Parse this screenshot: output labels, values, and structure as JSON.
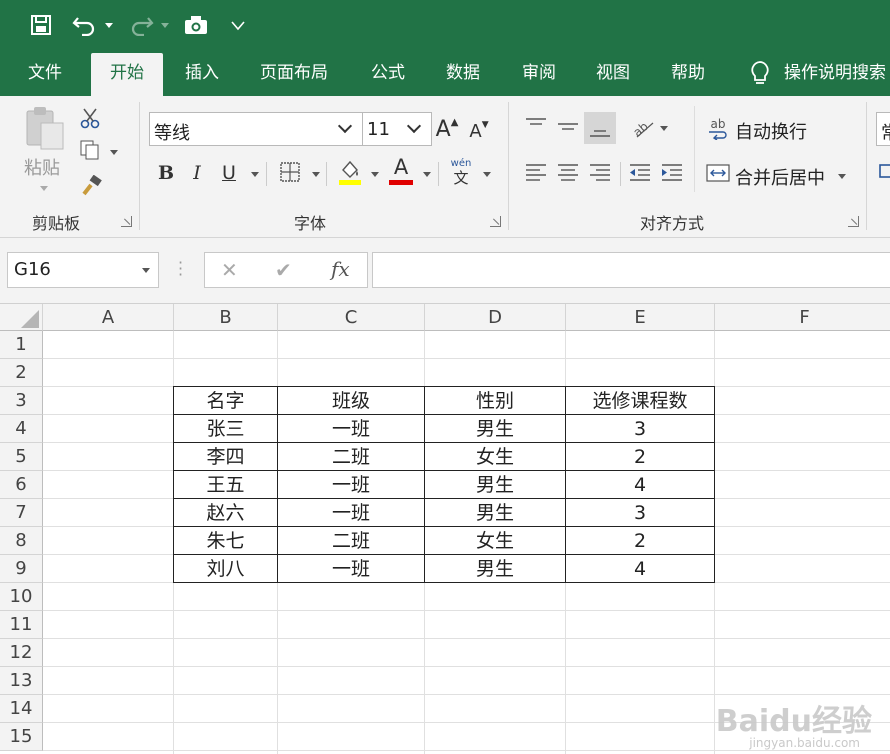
{
  "quick_access": {
    "save_icon": "save-icon",
    "undo_icon": "undo-icon",
    "redo_icon": "redo-icon",
    "camera_icon": "camera-icon",
    "customize_icon": "customize-qat-icon"
  },
  "tabs": [
    "文件",
    "开始",
    "插入",
    "页面布局",
    "公式",
    "数据",
    "审阅",
    "视图",
    "帮助"
  ],
  "tell_me": "操作说明搜索",
  "ribbon": {
    "clipboard": {
      "paste_label": "粘贴",
      "group_label": "剪贴板"
    },
    "font": {
      "font_name": "等线",
      "font_size": "11",
      "bold": "B",
      "italic": "I",
      "underline": "U",
      "grow_font": "A",
      "shrink_font": "A",
      "font_color_letter": "A",
      "phonetic_top": "wén",
      "phonetic_bottom": "文",
      "group_label": "字体"
    },
    "alignment": {
      "wrap_text": "自动换行",
      "merge_center": "合并后居中",
      "wrap_icon_text": "ab",
      "group_label": "对齐方式"
    },
    "number": {
      "format_partial": "常"
    }
  },
  "formula_bar": {
    "name_box": "G16",
    "cancel": "✕",
    "enter": "✔",
    "fx": "fx",
    "formula": ""
  },
  "sheet": {
    "columns": [
      "A",
      "B",
      "C",
      "D",
      "E",
      "F"
    ],
    "rows": [
      "1",
      "2",
      "3",
      "4",
      "5",
      "6",
      "7",
      "8",
      "9",
      "10",
      "11",
      "12",
      "13",
      "14",
      "15"
    ],
    "table": {
      "header": [
        "名字",
        "班级",
        "性别",
        "选修课程数"
      ],
      "rows": [
        [
          "张三",
          "一班",
          "男生",
          "3"
        ],
        [
          "李四",
          "二班",
          "女生",
          "2"
        ],
        [
          "王五",
          "一班",
          "男生",
          "4"
        ],
        [
          "赵六",
          "一班",
          "男生",
          "3"
        ],
        [
          "朱七",
          "二班",
          "女生",
          "2"
        ],
        [
          "刘八",
          "一班",
          "男生",
          "4"
        ]
      ]
    }
  },
  "watermark": {
    "brand": "Baidu经验",
    "url": "jingyan.baidu.com"
  },
  "colors": {
    "excel_green": "#217346",
    "ribbon_bg": "#f3f3f3",
    "highlight_yellow": "#ffff00",
    "font_red": "#e00000"
  }
}
